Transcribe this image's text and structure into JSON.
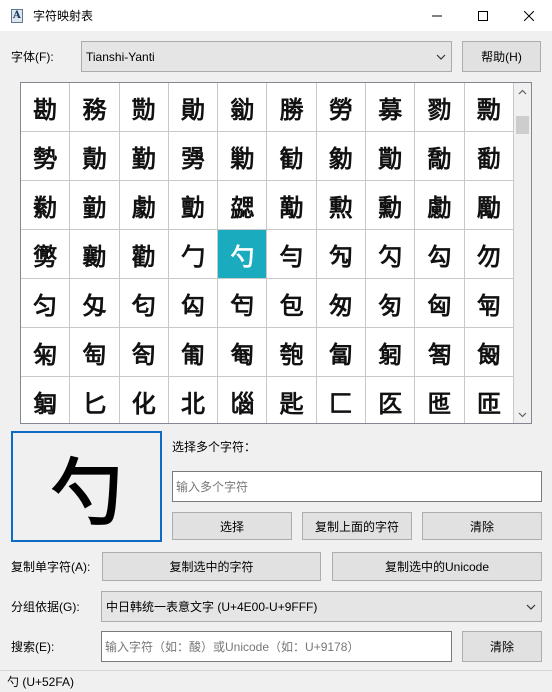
{
  "window": {
    "title": "字符映射表",
    "minimize_icon": "minimize-icon",
    "maximize_icon": "maximize-icon",
    "close_icon": "close-icon"
  },
  "font_row": {
    "label": "字体(F):",
    "selected_font": "Tianshi-Yanti",
    "help_button": "帮助(H)"
  },
  "char_grid": {
    "selected_char": "勺",
    "rows": [
      [
        "勘",
        "務",
        "勚",
        "勛",
        "勜",
        "勝",
        "勞",
        "募",
        "勠",
        "勡"
      ],
      [
        "勢",
        "勣",
        "勤",
        "勥",
        "勦",
        "勧",
        "勨",
        "勩",
        "勪",
        "勫"
      ],
      [
        "勬",
        "勭",
        "勮",
        "勯",
        "勰",
        "勱",
        "勲",
        "勳",
        "勴",
        "勵"
      ],
      [
        "勶",
        "勷",
        "勸",
        "勹",
        "勺",
        "勻",
        "勼",
        "勽",
        "勾",
        "勿"
      ],
      [
        "匀",
        "匁",
        "匂",
        "匃",
        "匄",
        "包",
        "匆",
        "匇",
        "匈",
        "匉"
      ],
      [
        "匊",
        "匋",
        "匌",
        "匍",
        "匎",
        "匏",
        "匐",
        "匑",
        "匒",
        "匓"
      ],
      [
        "匔",
        "匕",
        "化",
        "北",
        "匘",
        "匙",
        "匚",
        "匛",
        "匜",
        "匝"
      ]
    ]
  },
  "multi_select": {
    "label": "选择多个字符：",
    "input_placeholder": "输入多个字符",
    "select_button": "选择",
    "copy_above_button": "复制上面的字符",
    "clear_button": "清除"
  },
  "copy_row": {
    "label": "复制单字符(A):",
    "copy_char_button": "复制选中的字符",
    "copy_unicode_button": "复制选中的Unicode"
  },
  "group_row": {
    "label": "分组依据(G):",
    "selected": "中日韩统一表意文字 (U+4E00-U+9FFF)"
  },
  "search_row": {
    "label": "搜索(E):",
    "placeholder": "输入字符（如：酸）或Unicode（如：U+9178）",
    "clear_button": "清除"
  },
  "status": {
    "text": "勺 (U+52FA)"
  }
}
